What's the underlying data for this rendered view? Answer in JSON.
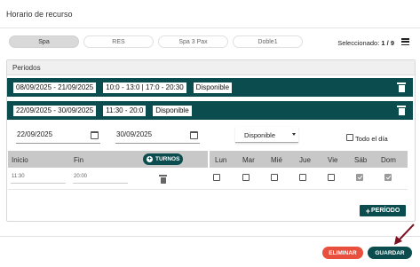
{
  "dialog": {
    "title": "Horario de recurso"
  },
  "tabs": [
    {
      "label": "Spa",
      "active": true
    },
    {
      "label": "RES",
      "active": false
    },
    {
      "label": "Spa 3 Pax",
      "active": false
    },
    {
      "label": "Doble1",
      "active": false
    }
  ],
  "selection": {
    "label": "Seleccionado:",
    "value": "1 / 9"
  },
  "periods_panel": {
    "title": "Periodos",
    "periods": [
      {
        "dates": "08/09/2025 - 21/09/2025",
        "hours": "10:0 - 13:0 | 17:0 - 20:30",
        "status": "Disponible"
      },
      {
        "dates": "22/09/2025 - 30/09/2025",
        "hours": "11:30 - 20:0",
        "status": "Disponible"
      }
    ],
    "editor": {
      "start_date": "22/09/2025",
      "end_date": "30/09/2025",
      "status_select": "Disponible",
      "all_day_label": "Todo el día",
      "all_day_checked": false,
      "columns": {
        "start": "Inicio",
        "end": "Fin",
        "turnos_button": "TURNOS"
      },
      "days": [
        {
          "label": "Lun",
          "checked": false
        },
        {
          "label": "Mar",
          "checked": false
        },
        {
          "label": "Mié",
          "checked": false
        },
        {
          "label": "Jue",
          "checked": false
        },
        {
          "label": "Vie",
          "checked": false
        },
        {
          "label": "Sáb",
          "checked": true
        },
        {
          "label": "Dom",
          "checked": true
        }
      ],
      "shift": {
        "start": "11:30",
        "end": "20:00"
      }
    },
    "add_period_button": "PERÍODO"
  },
  "footer": {
    "delete_button": "ELIMINAR",
    "save_button": "GUARDAR"
  },
  "colors": {
    "primary": "#0b4d4f",
    "danger": "#e94f3d",
    "arrow": "#7a1020"
  }
}
